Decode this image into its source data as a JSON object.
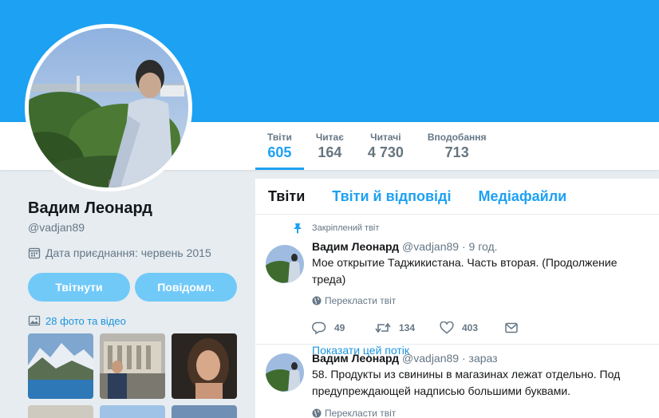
{
  "colors": {
    "banner": "#1da1f2",
    "accent": "#1da1f2",
    "button": "#71c9f8"
  },
  "profile": {
    "name": "Вадим Леонард",
    "handle": "@vadjan89",
    "joined": "Дата приєднання: червень 2015",
    "buttons": {
      "tweet": "Твітнути",
      "message": "Повідомл."
    },
    "media_link": "28 фото та відео",
    "icons": {
      "calendar": "calendar-icon",
      "media": "image-icon"
    }
  },
  "stats": [
    {
      "label": "Твіти",
      "value": "605"
    },
    {
      "label": "Читає",
      "value": "164"
    },
    {
      "label": "Читачі",
      "value": "4 730"
    },
    {
      "label": "Вподобання",
      "value": "713"
    }
  ],
  "tabs": [
    "Твіти",
    "Твіти й відповіді",
    "Медіафайли"
  ],
  "tweets": [
    {
      "pinned_label": "Закріплений твіт",
      "name": "Вадим Леонард",
      "handle": "@vadjan89",
      "time": "· 9 год.",
      "text": "Мое открытие Таджикистана. Часть вторая. (Продолжение треда)",
      "translate": "Перекласти твіт",
      "replies": "49",
      "retweets": "134",
      "likes": "403",
      "thread_link": "Показати цей потік"
    },
    {
      "name": "Вадим Леонард",
      "handle": "@vadjan89",
      "time": "· зараз",
      "text": "58. Продукты из свинины в магазинах лежат отдельно. Под предупреждающей надписью большими буквами.",
      "translate": "Перекласти твіт"
    }
  ]
}
